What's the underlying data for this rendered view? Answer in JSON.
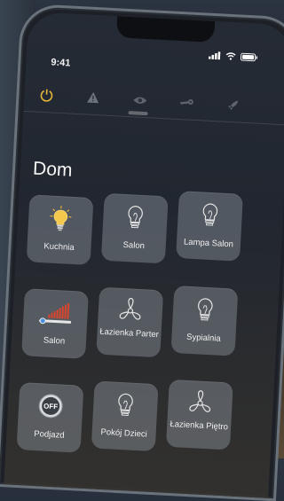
{
  "status_bar": {
    "time": "9:41"
  },
  "tabs": [
    {
      "icon": "power-icon",
      "active": true
    },
    {
      "icon": "alert-triangle-icon",
      "active": false
    },
    {
      "icon": "eye-icon",
      "active": false
    },
    {
      "icon": "wrench-icon",
      "active": false
    },
    {
      "icon": "rocket-icon",
      "active": false
    }
  ],
  "page": {
    "title": "Dom"
  },
  "tiles": [
    {
      "label": "Kuchnia",
      "icon": "lightbulb-on-icon"
    },
    {
      "label": "Salon",
      "icon": "lightbulb-icon"
    },
    {
      "label": "Lampa Salon",
      "icon": "lightbulb-icon"
    },
    {
      "label": "Salon",
      "icon": "slider-bars-icon"
    },
    {
      "label": "Łazienka Parter",
      "icon": "fan-icon"
    },
    {
      "label": "Sypialnia",
      "icon": "lightbulb-icon"
    },
    {
      "label": "Podjazd",
      "icon": "off-button-icon"
    },
    {
      "label": "Pokój Dzieci",
      "icon": "lightbulb-icon"
    },
    {
      "label": "Łazienka Piętro",
      "icon": "fan-icon"
    }
  ],
  "colors": {
    "active_icon": "#e7b63a",
    "tile_bg": "#969ea8",
    "slider_accent": "#d8452c"
  }
}
